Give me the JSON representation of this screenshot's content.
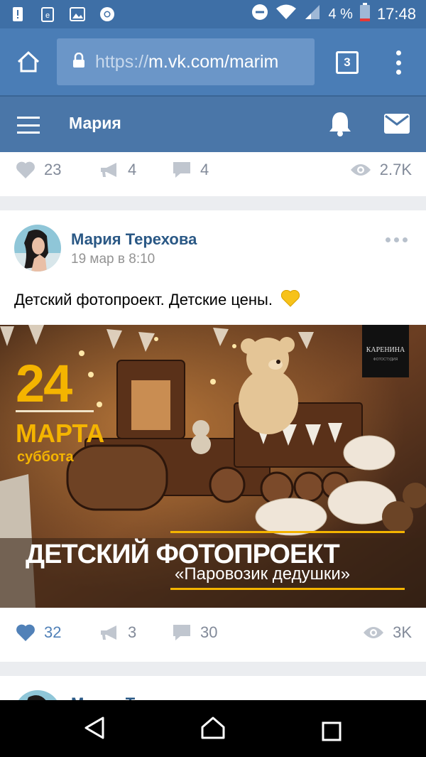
{
  "status_bar": {
    "battery_percent": "4 %",
    "time": "17:48",
    "icons": [
      "alert-icon",
      "clipboard-icon",
      "image-icon",
      "chrome-icon",
      "do-not-disturb-icon",
      "wifi-icon",
      "signal-icon",
      "battery-icon"
    ]
  },
  "browser": {
    "url_scheme": "https://",
    "url_host": "m.vk.com/marim",
    "tab_count": "3"
  },
  "vk_header": {
    "title": "Мария"
  },
  "prev_post": {
    "likes": "23",
    "reposts": "4",
    "comments": "4",
    "views": "2.7K"
  },
  "post": {
    "author": "Мария Терехова",
    "date": "19 мар в 8:10",
    "text": "Детский фотопроект. Детские цены.",
    "emoji": "yellow-heart",
    "image": {
      "day": "24",
      "month": "МАРТА",
      "weekday": "суббота",
      "headline": "ДЕТСКИЙ ФОТОПРОЕКТ",
      "subtitle": "«Паровозик дедушки»",
      "logo_text": "КАРЕНИНА"
    },
    "likes": "32",
    "reposts": "3",
    "comments": "30",
    "views": "3K",
    "liked": true
  },
  "next_post": {
    "author_partial": "Мария Т"
  },
  "colors": {
    "vk_blue": "#4a76a8",
    "browser_blue": "#4a7db6",
    "link_blue": "#2a5885",
    "liked_blue": "#5181b8"
  }
}
